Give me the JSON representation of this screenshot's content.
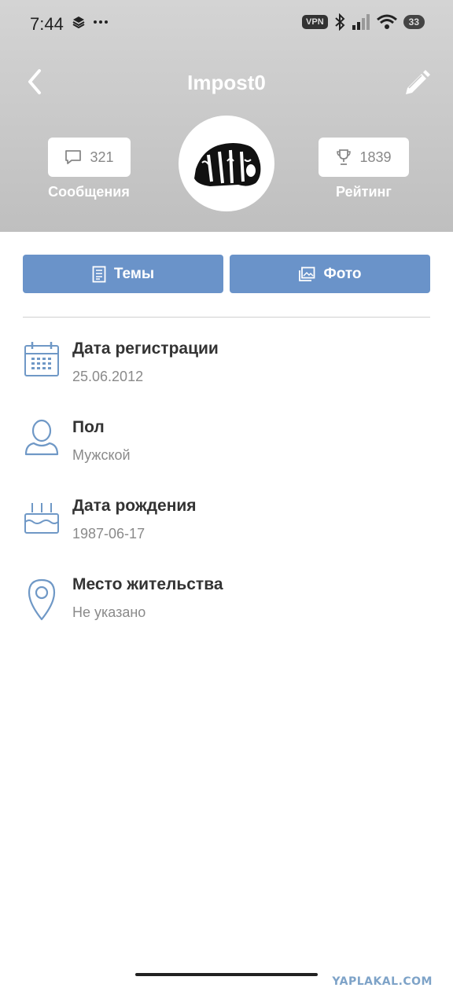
{
  "status_bar": {
    "time": "7:44",
    "vpn": "VPN",
    "battery": "33"
  },
  "header": {
    "title": "Impost0",
    "messages_count": "321",
    "messages_label": "Сообщения",
    "rating_value": "1839",
    "rating_label": "Рейтинг"
  },
  "tabs": {
    "topics": "Темы",
    "photo": "Фото"
  },
  "info": [
    {
      "label": "Дата регистрации",
      "value": "25.06.2012",
      "icon": "calendar-icon"
    },
    {
      "label": "Пол",
      "value": "Мужской",
      "icon": "person-icon"
    },
    {
      "label": "Дата рождения",
      "value": "1987-06-17",
      "icon": "birthday-cake-icon"
    },
    {
      "label": "Место жительства",
      "value": "Не указано",
      "icon": "location-pin-icon"
    }
  ],
  "watermark": "YAPLAKAL.COM",
  "colors": {
    "accent": "#6a93c9",
    "icon": "#6f98c6",
    "header_bg": "#c8c8c8"
  }
}
